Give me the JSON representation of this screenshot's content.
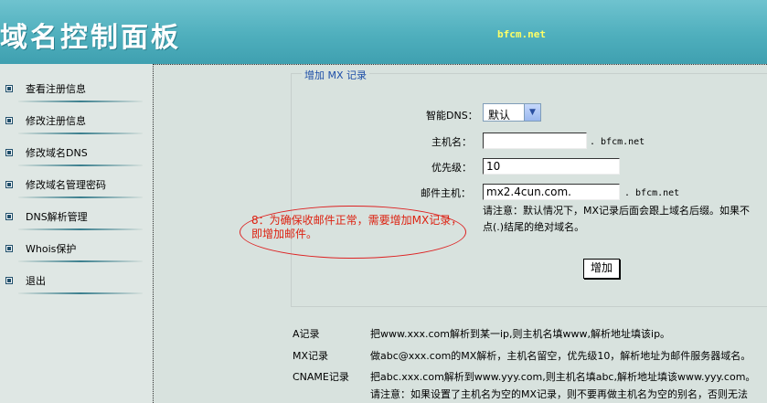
{
  "header": {
    "title": "域名控制面板",
    "site": "bfcm.net"
  },
  "sidebar": {
    "items": [
      {
        "label": "查看注册信息"
      },
      {
        "label": "修改注册信息"
      },
      {
        "label": "修改域名DNS"
      },
      {
        "label": "修改域名管理密码"
      },
      {
        "label": "DNS解析管理"
      },
      {
        "label": "Whois保护"
      },
      {
        "label": "退出"
      }
    ]
  },
  "form": {
    "legend": "增加 MX 记录",
    "dns_label": "智能DNS：",
    "dns_value": "默认",
    "host_label": "主机名：",
    "host_value": "",
    "host_suffix": ". bfcm.net",
    "priority_label": "优先级：",
    "priority_value": "10",
    "mailhost_label": "邮件主机：",
    "mailhost_value": "mx2.4cun.com.",
    "mailhost_suffix": ". bfcm.net",
    "note_line1": "请注意：默认情况下，MX记录后面会跟上域名后缀。如果不",
    "note_line2": "点(.)结尾的绝对域名。",
    "submit_label": "增加"
  },
  "annotation": {
    "text": "8：为确保收邮件正常，需要增加MX记录，即增加邮件。"
  },
  "help": [
    {
      "key": "A记录",
      "value": "把www.xxx.com解析到某一ip,则主机名填www,解析地址填该ip。"
    },
    {
      "key": "MX记录",
      "value": "做abc@xxx.com的MX解析，主机名留空，优先级10，解析地址为邮件服务器域名。"
    },
    {
      "key": "CNAME记录",
      "value": "把abc.xxx.com解析到www.yyy.com,则主机名填abc,解析地址填该www.yyy.com。"
    }
  ],
  "help_note": "请注意：如果设置了主机名为空的MX记录，则不要再做主机名为空的别名，否则无法"
}
